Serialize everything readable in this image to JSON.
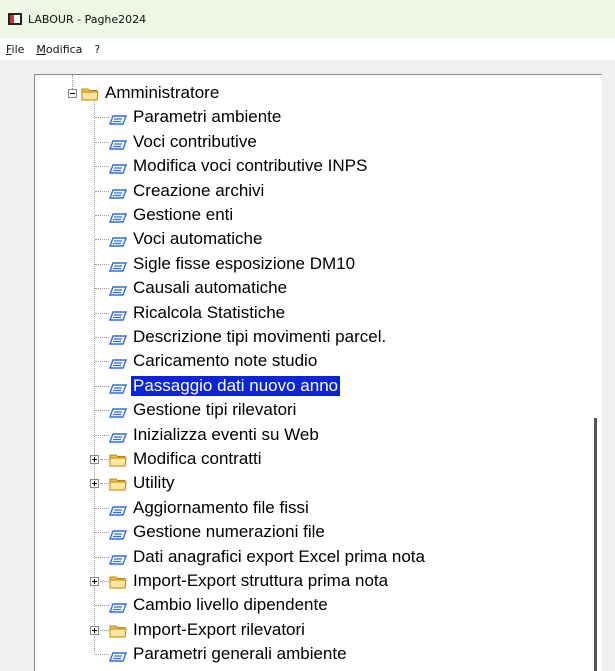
{
  "window": {
    "title": "LABOUR - Paghe2024"
  },
  "menu": {
    "items": [
      {
        "key": "F",
        "rest": "ile"
      },
      {
        "key": "M",
        "rest": "odifica"
      },
      {
        "key": "",
        "rest": "?"
      }
    ]
  },
  "tree": {
    "root": {
      "label": "Amministratore",
      "expanded": true
    },
    "items": [
      {
        "label": "Parametri ambiente",
        "type": "leaf"
      },
      {
        "label": "Voci contributive",
        "type": "leaf"
      },
      {
        "label": "Modifica voci contributive INPS",
        "type": "leaf"
      },
      {
        "label": "Creazione archivi",
        "type": "leaf"
      },
      {
        "label": "Gestione enti",
        "type": "leaf"
      },
      {
        "label": "Voci automatiche",
        "type": "leaf"
      },
      {
        "label": "Sigle fisse esposizione DM10",
        "type": "leaf"
      },
      {
        "label": "Causali automatiche",
        "type": "leaf"
      },
      {
        "label": "Ricalcola Statistiche",
        "type": "leaf"
      },
      {
        "label": "Descrizione tipi movimenti parcel.",
        "type": "leaf"
      },
      {
        "label": "Caricamento note studio",
        "type": "leaf"
      },
      {
        "label": "Passaggio dati nuovo anno",
        "type": "leaf",
        "selected": true
      },
      {
        "label": "Gestione tipi rilevatori",
        "type": "leaf"
      },
      {
        "label": "Inizializza eventi su Web",
        "type": "leaf"
      },
      {
        "label": "Modifica contratti",
        "type": "folder"
      },
      {
        "label": "Utility",
        "type": "folder"
      },
      {
        "label": "Aggiornamento file fissi",
        "type": "leaf"
      },
      {
        "label": "Gestione numerazioni file",
        "type": "leaf"
      },
      {
        "label": "Dati anagrafici export Excel prima nota",
        "type": "leaf"
      },
      {
        "label": "Import-Export struttura prima nota",
        "type": "folder"
      },
      {
        "label": "Cambio livello dipendente",
        "type": "leaf"
      },
      {
        "label": "Import-Export rilevatori",
        "type": "folder"
      },
      {
        "label": "Parametri generali ambiente",
        "type": "leaf"
      }
    ]
  },
  "colors": {
    "selection": "#0a24d8",
    "folder": "#f2c94c",
    "file": "#2f6fd6"
  }
}
